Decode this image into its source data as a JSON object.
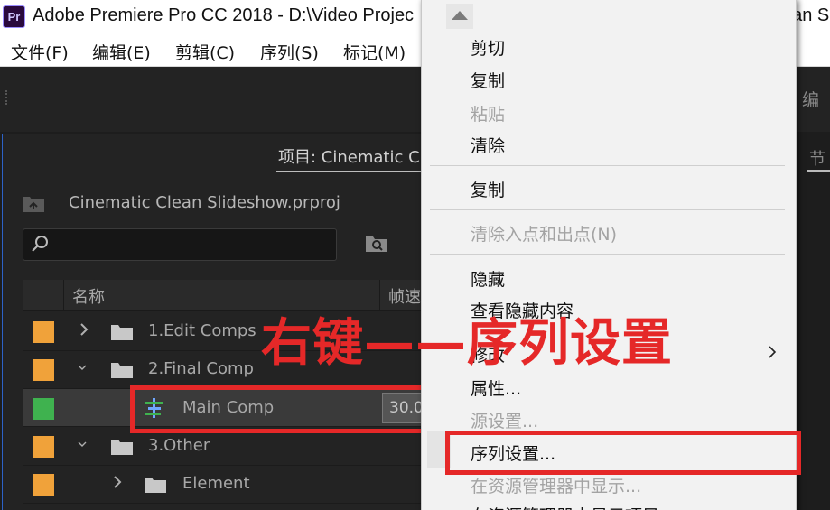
{
  "window": {
    "app_icon": "Pr",
    "title": "Adobe Premiere Pro CC 2018 - D:\\Video Projec",
    "title_tail": "ean S"
  },
  "menu": [
    "文件(F)",
    "编辑(E)",
    "剪辑(C)",
    "序列(S)",
    "标记(M)"
  ],
  "right_panel_tabs": [
    "编",
    "节"
  ],
  "project_panel": {
    "title": "项目: Cinematic C",
    "project_file": "Cinematic Clean Slideshow.prproj",
    "search": {
      "value": "",
      "placeholder": ""
    },
    "columns": [
      "名称",
      "帧速"
    ],
    "rows": [
      {
        "name": "1.Edit Comps",
        "kind": "folder",
        "expanded": false,
        "color": "#f0a23a"
      },
      {
        "name": "2.Final Comp",
        "kind": "folder",
        "expanded": true,
        "color": "#f0a23a"
      },
      {
        "name": "Main Comp",
        "kind": "sequence",
        "fps": "30.0",
        "color": "#3fb24f",
        "selected": true
      },
      {
        "name": "3.Other",
        "kind": "folder",
        "expanded": true,
        "color": "#f0a23a"
      },
      {
        "name": "Element",
        "kind": "folder",
        "expanded": false,
        "color": "#f0a23a"
      }
    ]
  },
  "context_menu": {
    "items": [
      {
        "label": "剪切",
        "enabled": true
      },
      {
        "label": "复制",
        "enabled": true
      },
      {
        "label": "粘贴",
        "enabled": false
      },
      {
        "label": "清除",
        "enabled": true
      },
      {
        "label": "复制",
        "enabled": true
      },
      {
        "label": "清除入点和出点(N)",
        "enabled": false
      },
      {
        "label": "隐藏",
        "enabled": true
      },
      {
        "label": "查看隐藏内容",
        "enabled": true
      },
      {
        "label": "修改",
        "enabled": true,
        "submenu": true
      },
      {
        "label": "属性...",
        "enabled": true
      },
      {
        "label": "源设置...",
        "enabled": false
      },
      {
        "label": "序列设置...",
        "enabled": true,
        "highlighted": true
      },
      {
        "label": "在资源管理器中显示...",
        "enabled": false
      },
      {
        "label": "在资源管理器中显示项目",
        "enabled": true
      }
    ]
  },
  "annotation": {
    "text": "右键——序列设置",
    "color": "#e52828"
  },
  "colors": {
    "accent": "#2d62c7",
    "folder_label": "#f0a23a",
    "sequence_label": "#3fb24f",
    "highlight": "#e52828"
  }
}
